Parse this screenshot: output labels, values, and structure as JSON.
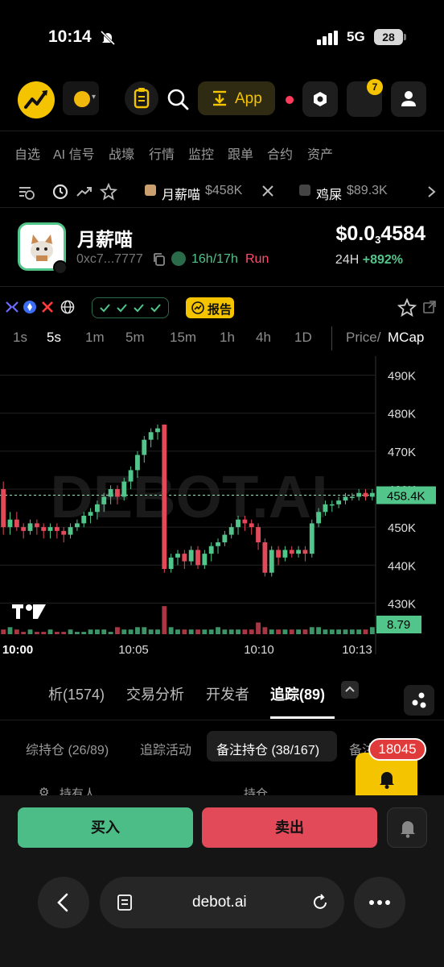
{
  "status_bar": {
    "time": "10:14",
    "network": "5G",
    "battery": "28"
  },
  "header": {
    "app_button_label": "App",
    "notification_count": "7"
  },
  "nav": {
    "items": [
      "自选",
      "AI 信号",
      "战壕",
      "行情",
      "监控",
      "跟单",
      "合约",
      "资产"
    ]
  },
  "watchlist": {
    "chips": [
      {
        "name": "月薪喵",
        "price": "$458K"
      },
      {
        "name": "鸡屎",
        "price": "$89.3K"
      }
    ]
  },
  "token": {
    "name": "月薪喵",
    "address": "0xc7...7777",
    "age": "16h/17h",
    "status": "Run",
    "price_prefix": "$0.0",
    "price_zeros": "3",
    "price_suffix": "4584",
    "change_label": "24H",
    "change_value": "+892%"
  },
  "social": {
    "report_label": "报告"
  },
  "timeframes": {
    "items": [
      "1s",
      "5s",
      "1m",
      "5m",
      "15m",
      "1h",
      "4h",
      "1D"
    ],
    "active": "5s",
    "mode_price": "Price/",
    "mode_mcap": "MCap"
  },
  "chart_data": {
    "type": "candlestick",
    "watermark": "DEBOT.AI",
    "y_ticks": [
      "490K",
      "480K",
      "470K",
      "460K",
      "450K",
      "440K",
      "430K"
    ],
    "y_range": [
      425,
      495
    ],
    "current_price_label": "458.4K",
    "current_price": 458.4,
    "volume_label": "8.79",
    "x_ticks": [
      "10:00",
      "10:05",
      "10:10",
      "10:13"
    ],
    "candles": [
      [
        460,
        450,
        462,
        448
      ],
      [
        450,
        452,
        454,
        448
      ],
      [
        452,
        450,
        454,
        449
      ],
      [
        450,
        449,
        451,
        447
      ],
      [
        449,
        451,
        452,
        448
      ],
      [
        451,
        450,
        452,
        448
      ],
      [
        450,
        449,
        451,
        447
      ],
      [
        449,
        450,
        451,
        447
      ],
      [
        450,
        449,
        451,
        447
      ],
      [
        449,
        448,
        450,
        446
      ],
      [
        448,
        450,
        451,
        447
      ],
      [
        450,
        451,
        452,
        449
      ],
      [
        451,
        453,
        454,
        450
      ],
      [
        453,
        454,
        455,
        451
      ],
      [
        454,
        456,
        457,
        452
      ],
      [
        456,
        458,
        459,
        454
      ],
      [
        458,
        460,
        461,
        456
      ],
      [
        460,
        458,
        461,
        456
      ],
      [
        458,
        462,
        463,
        457
      ],
      [
        462,
        465,
        466,
        460
      ],
      [
        465,
        469,
        470,
        463
      ],
      [
        469,
        473,
        474,
        467
      ],
      [
        473,
        475,
        476,
        471
      ],
      [
        475,
        476,
        477,
        473
      ],
      [
        477,
        439,
        477,
        438
      ],
      [
        439,
        442,
        443,
        438
      ],
      [
        442,
        443,
        444,
        440
      ],
      [
        443,
        441,
        444,
        439
      ],
      [
        441,
        444,
        445,
        440
      ],
      [
        444,
        440,
        445,
        439
      ],
      [
        440,
        443,
        444,
        439
      ],
      [
        443,
        445,
        446,
        441
      ],
      [
        445,
        446,
        447,
        443
      ],
      [
        446,
        448,
        449,
        445
      ],
      [
        448,
        450,
        451,
        447
      ],
      [
        450,
        452,
        453,
        448
      ],
      [
        452,
        451,
        453,
        449
      ],
      [
        451,
        450,
        452,
        448
      ],
      [
        450,
        446,
        451,
        444
      ],
      [
        446,
        438,
        447,
        437
      ],
      [
        438,
        444,
        445,
        437
      ],
      [
        444,
        442,
        445,
        440
      ],
      [
        442,
        444,
        445,
        441
      ],
      [
        444,
        443,
        445,
        442
      ],
      [
        443,
        444,
        445,
        442
      ],
      [
        444,
        443,
        445,
        441
      ],
      [
        443,
        451,
        452,
        442
      ],
      [
        451,
        454,
        455,
        450
      ],
      [
        454,
        456,
        457,
        453
      ],
      [
        456,
        456,
        457,
        454
      ],
      [
        456,
        457,
        458,
        455
      ],
      [
        457,
        458,
        459,
        456
      ],
      [
        458,
        458,
        459,
        457
      ],
      [
        458,
        459,
        460,
        457
      ],
      [
        459,
        458,
        460,
        457
      ],
      [
        458,
        459,
        460,
        457
      ]
    ],
    "volumes": [
      2,
      3,
      2,
      1,
      2,
      1,
      1,
      2,
      1,
      1,
      2,
      1,
      1,
      2,
      2,
      2,
      1,
      3,
      2,
      2,
      3,
      3,
      2,
      2,
      12,
      3,
      2,
      2,
      2,
      2,
      2,
      2,
      3,
      2,
      2,
      2,
      2,
      2,
      5,
      3,
      2,
      2,
      2,
      2,
      2,
      2,
      3,
      3,
      2,
      2,
      2,
      2,
      2,
      2,
      2,
      3
    ]
  },
  "tabs": {
    "items": [
      "析(1574)",
      "交易分析",
      "开发者",
      "追踪(89)"
    ],
    "active_index": 3
  },
  "subtabs": {
    "items": [
      "综持仓 (26/89)",
      "追踪活动",
      "备注持仓 (38/167)",
      "备注"
    ],
    "active_index": 2
  },
  "alert": {
    "count": "18045"
  },
  "holders": {
    "col_holder": "持有人",
    "col_position": "持仓"
  },
  "actions": {
    "buy_label": "买入",
    "sell_label": "卖出"
  },
  "browser": {
    "url": "debot.ai"
  },
  "colors": {
    "up": "#52c58a",
    "down": "#e24a5a",
    "accent": "#f5c400",
    "background": "#000000"
  }
}
